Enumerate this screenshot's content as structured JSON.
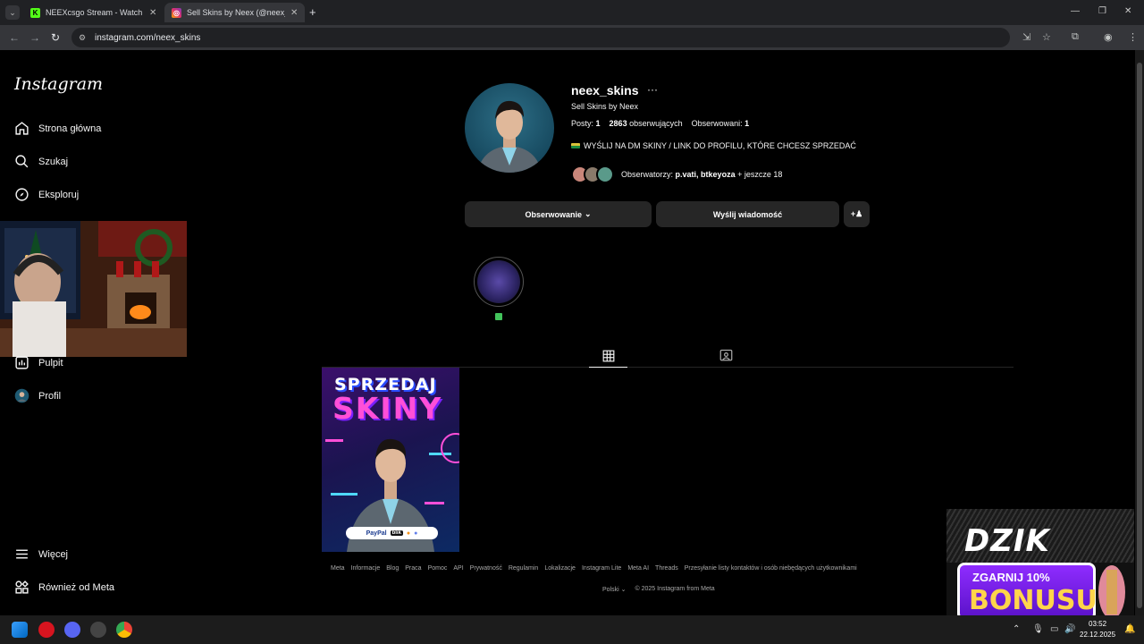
{
  "browser": {
    "tabs": [
      {
        "title": "NEEXcsgo Stream - Watch Live",
        "favicon": "kick-icon",
        "active": false
      },
      {
        "title": "Sell Skins by Neex (@neex_skin",
        "favicon": "instagram-icon",
        "active": true
      }
    ],
    "url": "instagram.com/neex_skins"
  },
  "sidebar": {
    "logo": "Instagram",
    "items": [
      {
        "label": "Strona główna",
        "icon": "home-icon"
      },
      {
        "label": "Szukaj",
        "icon": "search-icon"
      },
      {
        "label": "Eksploruj",
        "icon": "compass-icon"
      },
      {
        "label": "Pulpit",
        "icon": "dashboard-icon"
      },
      {
        "label": "Profil",
        "icon": "avatar"
      },
      {
        "label": "Więcej",
        "icon": "menu-icon"
      },
      {
        "label": "Również od Meta",
        "icon": "meta-icon"
      }
    ]
  },
  "profile": {
    "username": "neex_skins",
    "more": "···",
    "full_name": "Sell Skins by Neex",
    "posts_label": "Posty:",
    "posts_count": "1",
    "followers_count": "2863",
    "followers_label": "obserwujących",
    "following_label": "Obserwowani:",
    "following_count": "1",
    "bio": "WYŚLIJ NA DM SKINY / LINK DO PROFILU, KTÓRE CHCESZ SPRZEDAĆ",
    "followed_by_label": "Obserwatorzy:",
    "followed_by_names": "p.vati, btkeyoza",
    "followed_by_more": "+ jeszcze 18"
  },
  "actions": {
    "following_button": "Obserwowanie",
    "message_button": "Wyślij wiadomość"
  },
  "post": {
    "line1": "SPRZEDAJ",
    "line2": "SKINY",
    "pay_paypal": "PayPal",
    "pay_blik": "blik"
  },
  "footer": {
    "links": [
      "Meta",
      "Informacje",
      "Blog",
      "Praca",
      "Pomoc",
      "API",
      "Prywatność",
      "Regulamin",
      "Lokalizacje",
      "Instagram Lite",
      "Meta AI",
      "Threads",
      "Przesyłanie listy kontaktów i osób niebędących użytkownikami"
    ],
    "language": "Polski",
    "copyright": "© 2025 Instagram from Meta"
  },
  "ad": {
    "brand": "DZIK",
    "line1": "ZGARNIJ 10%",
    "line2": "BONUSU"
  },
  "taskbar": {
    "time": "03:52",
    "date": "22.12.2025"
  }
}
